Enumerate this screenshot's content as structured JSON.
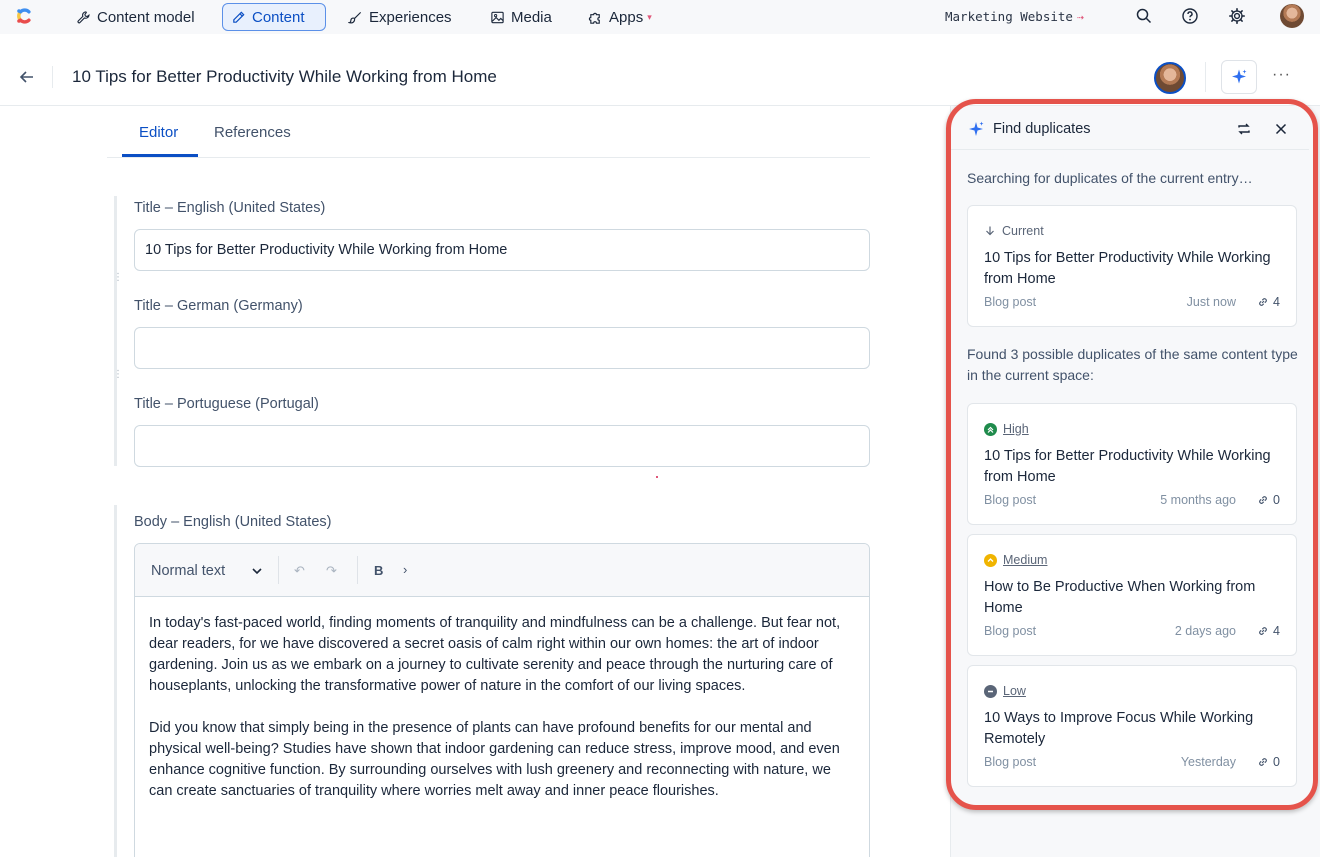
{
  "nav": {
    "items": [
      {
        "label": "Content model",
        "icon": "wrench-icon"
      },
      {
        "label": "Content",
        "icon": "pen-icon",
        "active": true
      },
      {
        "label": "Experiences",
        "icon": "brush-icon"
      },
      {
        "label": "Media",
        "icon": "image-icon"
      },
      {
        "label": "Apps",
        "icon": "puzzle-icon"
      }
    ],
    "space": "Marketing Website",
    "colors": {
      "accent": "#0b4fc4",
      "highlight": "#e5534b"
    }
  },
  "entry": {
    "title": "10 Tips for Better Productivity While Working from Home"
  },
  "tabs": {
    "editor": "Editor",
    "references": "References"
  },
  "fields": {
    "title_en": {
      "label": "Title – English (United States)",
      "value": "10 Tips for Better Productivity While Working from Home"
    },
    "title_de": {
      "label": "Title – German (Germany)",
      "value": ""
    },
    "title_pt": {
      "label": "Title – Portuguese (Portugal)",
      "value": ""
    },
    "body_en": {
      "label": "Body – English (United States)",
      "format": "Normal text",
      "bold": "B",
      "paragraphs": [
        "In today's fast-paced world, finding moments of tranquility and mindfulness can be a challenge. But fear not, dear readers, for we have discovered a secret oasis of calm right within our own homes: the art of indoor gardening. Join us as we embark on a journey to cultivate serenity and peace through the nurturing care of houseplants, unlocking the transformative power of nature in the comfort of our living spaces.",
        "Did you know that simply being in the presence of plants can have profound benefits for our mental and physical well-being? Studies have shown that indoor gardening can reduce stress, improve mood, and even enhance cognitive function. By surrounding ourselves with lush greenery and reconnecting with nature, we can create sanctuaries of tranquility where worries melt away and inner peace flourishes."
      ]
    }
  },
  "panel": {
    "title": "Find duplicates",
    "searching": "Searching for duplicates of the current entry…",
    "found": "Found 3 possible duplicates of the same content type in the current space:",
    "current": {
      "tag": "Current",
      "title": "10 Tips for Better Productivity While Working from Home",
      "type": "Blog post",
      "time": "Just now",
      "links": "4"
    },
    "duplicates": [
      {
        "level": "High",
        "title": "10 Tips for Better Productivity While Working from Home",
        "type": "Blog post",
        "time": "5 months ago",
        "links": "0"
      },
      {
        "level": "Medium",
        "title": "How to Be Productive When Working from Home",
        "type": "Blog post",
        "time": "2 days ago",
        "links": "4"
      },
      {
        "level": "Low",
        "title": "10 Ways to Improve Focus While Working Remotely",
        "type": "Blog post",
        "time": "Yesterday",
        "links": "0"
      }
    ]
  }
}
